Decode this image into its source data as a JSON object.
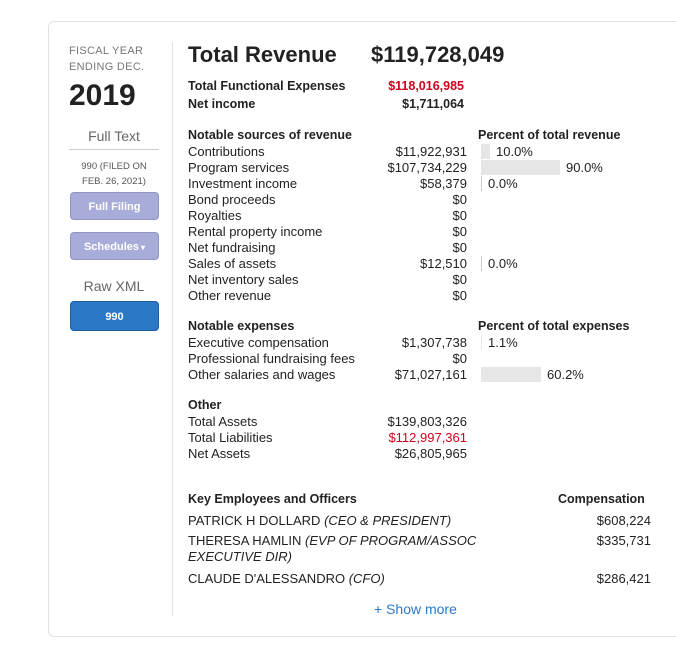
{
  "left": {
    "fiscal_label_line1": "FISCAL YEAR",
    "fiscal_label_line2": "ENDING DEC.",
    "year": "2019",
    "full_text": "Full Text",
    "filed_line1": "990 (FILED ON",
    "filed_line2": "FEB. 26, 2021)",
    "full_filing_button": "Full Filing",
    "schedules_button": "Schedules",
    "raw_xml": "Raw XML",
    "form_button": "990"
  },
  "summary": {
    "total_revenue_label": "Total Revenue",
    "total_revenue_value": "$119,728,049",
    "functional_expenses_label": "Total Functional Expenses",
    "functional_expenses_value": "$118,016,985",
    "net_income_label": "Net income",
    "net_income_value": "$1,711,064"
  },
  "revenue": {
    "heading": "Notable sources of revenue",
    "pct_heading": "Percent of total revenue",
    "rows": [
      {
        "label": "Contributions",
        "value": "$11,922,931",
        "pct": "10.0%",
        "pct_num": 10.0
      },
      {
        "label": "Program services",
        "value": "$107,734,229",
        "pct": "90.0%",
        "pct_num": 90.0
      },
      {
        "label": "Investment income",
        "value": "$58,379",
        "pct": "0.0%",
        "pct_num": 0.0
      },
      {
        "label": "Bond proceeds",
        "value": "$0",
        "pct": "",
        "pct_num": null
      },
      {
        "label": "Royalties",
        "value": "$0",
        "pct": "",
        "pct_num": null
      },
      {
        "label": "Rental property income",
        "value": "$0",
        "pct": "",
        "pct_num": null
      },
      {
        "label": "Net fundraising",
        "value": "$0",
        "pct": "",
        "pct_num": null
      },
      {
        "label": "Sales of assets",
        "value": "$12,510",
        "pct": "0.0%",
        "pct_num": 0.0
      },
      {
        "label": "Net inventory sales",
        "value": "$0",
        "pct": "",
        "pct_num": null
      },
      {
        "label": "Other revenue",
        "value": "$0",
        "pct": "",
        "pct_num": null
      }
    ]
  },
  "expenses": {
    "heading": "Notable expenses",
    "pct_heading": "Percent of total expenses",
    "rows": [
      {
        "label": "Executive compensation",
        "value": "$1,307,738",
        "pct": "1.1%",
        "pct_num": 1.1
      },
      {
        "label": "Professional fundraising fees",
        "value": "$0",
        "pct": "",
        "pct_num": null
      },
      {
        "label": "Other salaries and wages",
        "value": "$71,027,161",
        "pct": "60.2%",
        "pct_num": 60.2
      }
    ]
  },
  "other": {
    "heading": "Other",
    "rows": [
      {
        "label": "Total Assets",
        "value": "$139,803,326",
        "color": "#222222"
      },
      {
        "label": "Total Liabilities",
        "value": "$112,997,361",
        "color": "#d0021b"
      },
      {
        "label": "Net Assets",
        "value": "$26,805,965",
        "color": "#222222"
      }
    ]
  },
  "employees": {
    "heading": "Key Employees and Officers",
    "comp_heading": "Compensation",
    "rows": [
      {
        "name": "PATRICK H DOLLARD",
        "title": "(CEO & PRESIDENT)",
        "comp": "$608,224"
      },
      {
        "name": "THERESA HAMLIN",
        "title": "(EVP OF PROGRAM/ASSOC EXECUTIVE DIR)",
        "comp": "$335,731"
      },
      {
        "name": "CLAUDE D'ALESSANDRO",
        "title": "(CFO)",
        "comp": "$286,421"
      }
    ],
    "show_more": "+ Show more"
  },
  "colors": {
    "accent_blue": "#2a78c6",
    "button_lavender": "#a8acd8",
    "negative_red": "#d0021b",
    "bar_gray": "#e6e6e6"
  }
}
